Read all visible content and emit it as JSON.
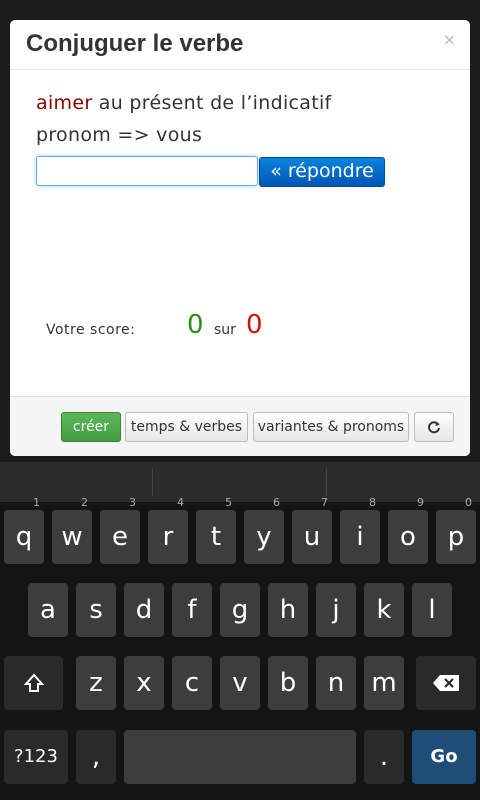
{
  "modal": {
    "title": "Conjuguer le verbe",
    "close": "×",
    "question": {
      "verb": "aimer",
      "rest": " au présent de l’indicatif"
    },
    "pronoun": "pronom => vous",
    "answer": {
      "value": "",
      "placeholder": "",
      "button": "« répondre"
    },
    "score": {
      "label": "Votre score:",
      "correct": "0",
      "sep": "sur",
      "total": "0"
    },
    "footer": {
      "create": "créer",
      "tenses": "temps & verbes",
      "variants": "variantes & pronoms",
      "refresh_icon": "refresh-icon"
    }
  },
  "keyboard": {
    "row1": [
      {
        "k": "q",
        "h": "1"
      },
      {
        "k": "w",
        "h": "2"
      },
      {
        "k": "e",
        "h": "3"
      },
      {
        "k": "r",
        "h": "4"
      },
      {
        "k": "t",
        "h": "5"
      },
      {
        "k": "y",
        "h": "6"
      },
      {
        "k": "u",
        "h": "7"
      },
      {
        "k": "i",
        "h": "8"
      },
      {
        "k": "o",
        "h": "9"
      },
      {
        "k": "p",
        "h": "0"
      }
    ],
    "row2": [
      "a",
      "s",
      "d",
      "f",
      "g",
      "h",
      "j",
      "k",
      "l"
    ],
    "row3": [
      "z",
      "x",
      "c",
      "v",
      "b",
      "n",
      "m"
    ],
    "shift_icon": "shift-icon",
    "backspace_icon": "backspace-icon",
    "numbers": "?123",
    "comma": ",",
    "period": ".",
    "go": "Go",
    "colors": {
      "key": "#3d3d3d",
      "go": "#1e4e77"
    }
  }
}
